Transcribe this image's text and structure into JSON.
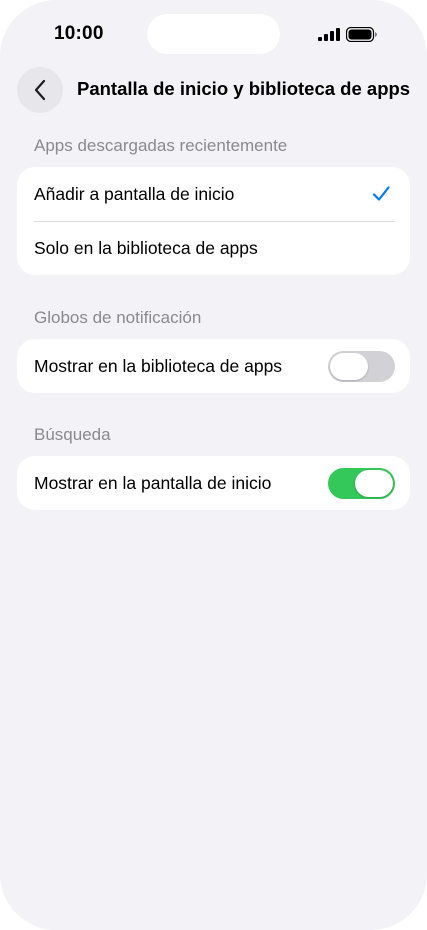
{
  "status_bar": {
    "time": "10:00",
    "signal_icon": "cellular-signal-icon",
    "battery_icon": "battery-icon"
  },
  "header": {
    "back_icon": "chevron-left-icon",
    "title": "Pantalla de inicio y biblioteca de apps"
  },
  "sections": [
    {
      "title": "Apps descargadas recientemente",
      "rows": [
        {
          "label": "Añadir a pantalla de inicio",
          "selected": true
        },
        {
          "label": "Solo en la biblioteca de apps",
          "selected": false
        }
      ]
    },
    {
      "title": "Globos de notificación",
      "rows": [
        {
          "label": "Mostrar en la biblioteca de apps",
          "toggle": false
        }
      ]
    },
    {
      "title": "Búsqueda",
      "rows": [
        {
          "label": "Mostrar en la pantalla de inicio",
          "toggle": true
        }
      ]
    }
  ],
  "colors": {
    "background": "#f2f2f7",
    "card": "#ffffff",
    "accent": "#007aff",
    "toggle_on": "#34c759",
    "toggle_off": "#d1d1d6",
    "section_header": "#8a8a8e"
  }
}
